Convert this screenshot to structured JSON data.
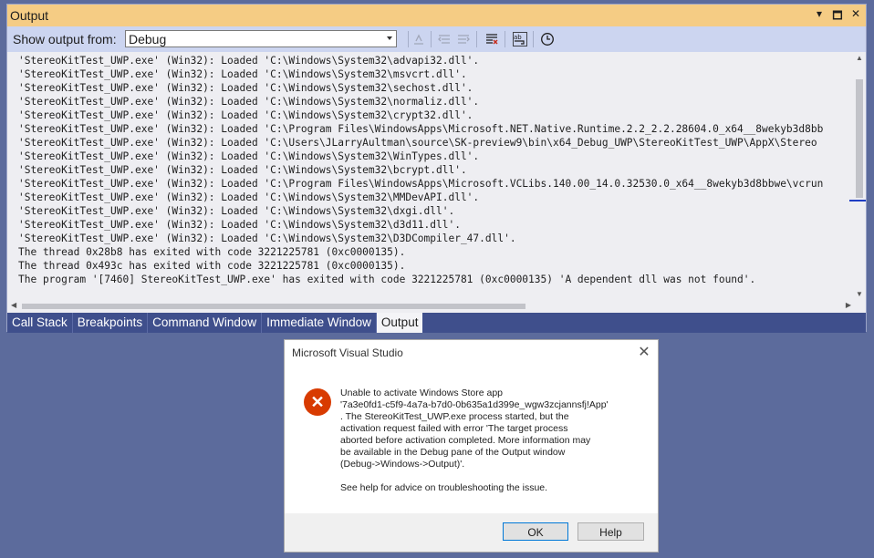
{
  "window": {
    "title": "Output"
  },
  "title_icons": [
    "dropdown-icon",
    "maximize-icon",
    "close-icon"
  ],
  "toolbar": {
    "show_output_label": "Show output from:",
    "source_value": "Debug"
  },
  "output_lines": [
    "'StereoKitTest_UWP.exe' (Win32): Loaded 'C:\\Windows\\System32\\advapi32.dll'.",
    "'StereoKitTest_UWP.exe' (Win32): Loaded 'C:\\Windows\\System32\\msvcrt.dll'.",
    "'StereoKitTest_UWP.exe' (Win32): Loaded 'C:\\Windows\\System32\\sechost.dll'.",
    "'StereoKitTest_UWP.exe' (Win32): Loaded 'C:\\Windows\\System32\\normaliz.dll'.",
    "'StereoKitTest_UWP.exe' (Win32): Loaded 'C:\\Windows\\System32\\crypt32.dll'.",
    "'StereoKitTest_UWP.exe' (Win32): Loaded 'C:\\Program Files\\WindowsApps\\Microsoft.NET.Native.Runtime.2.2_2.2.28604.0_x64__8wekyb3d8bb",
    "'StereoKitTest_UWP.exe' (Win32): Loaded 'C:\\Users\\JLarryAultman\\source\\SK-preview9\\bin\\x64_Debug_UWP\\StereoKitTest_UWP\\AppX\\Stereo",
    "'StereoKitTest_UWP.exe' (Win32): Loaded 'C:\\Windows\\System32\\WinTypes.dll'.",
    "'StereoKitTest_UWP.exe' (Win32): Loaded 'C:\\Windows\\System32\\bcrypt.dll'.",
    "'StereoKitTest_UWP.exe' (Win32): Loaded 'C:\\Program Files\\WindowsApps\\Microsoft.VCLibs.140.00_14.0.32530.0_x64__8wekyb3d8bbwe\\vcrun",
    "'StereoKitTest_UWP.exe' (Win32): Loaded 'C:\\Windows\\System32\\MMDevAPI.dll'.",
    "'StereoKitTest_UWP.exe' (Win32): Loaded 'C:\\Windows\\System32\\dxgi.dll'.",
    "'StereoKitTest_UWP.exe' (Win32): Loaded 'C:\\Windows\\System32\\d3d11.dll'.",
    "'StereoKitTest_UWP.exe' (Win32): Loaded 'C:\\Windows\\System32\\D3DCompiler_47.dll'.",
    "The thread 0x28b8 has exited with code 3221225781 (0xc0000135).",
    "The thread 0x493c has exited with code 3221225781 (0xc0000135).",
    "The program '[7460] StereoKitTest_UWP.exe' has exited with code 3221225781 (0xc0000135) 'A dependent dll was not found'."
  ],
  "tabs": [
    {
      "label": "Call Stack",
      "active": false
    },
    {
      "label": "Breakpoints",
      "active": false
    },
    {
      "label": "Command Window",
      "active": false
    },
    {
      "label": "Immediate Window",
      "active": false
    },
    {
      "label": "Output",
      "active": true
    }
  ],
  "dialog": {
    "title": "Microsoft Visual Studio",
    "message": "Unable to activate Windows Store app\n'7a3e0fd1-c5f9-4a7a-b7d0-0b635a1d399e_wgw3zcjannsfj!App'\n. The StereoKitTest_UWP.exe process started, but the\nactivation request failed with error 'The target process\naborted before activation completed. More information may\nbe available in the Debug pane of the Output window\n(Debug->Windows->Output)'.",
    "help_text": "See help for advice on troubleshooting the issue.",
    "ok_label": "OK",
    "help_label": "Help"
  },
  "colors": {
    "title_bar": "#f5cc84",
    "toolbar": "#ccd5f0",
    "tab_strip": "#3f4f8c",
    "background": "#5c6b9c",
    "error_icon": "#d83b01"
  }
}
